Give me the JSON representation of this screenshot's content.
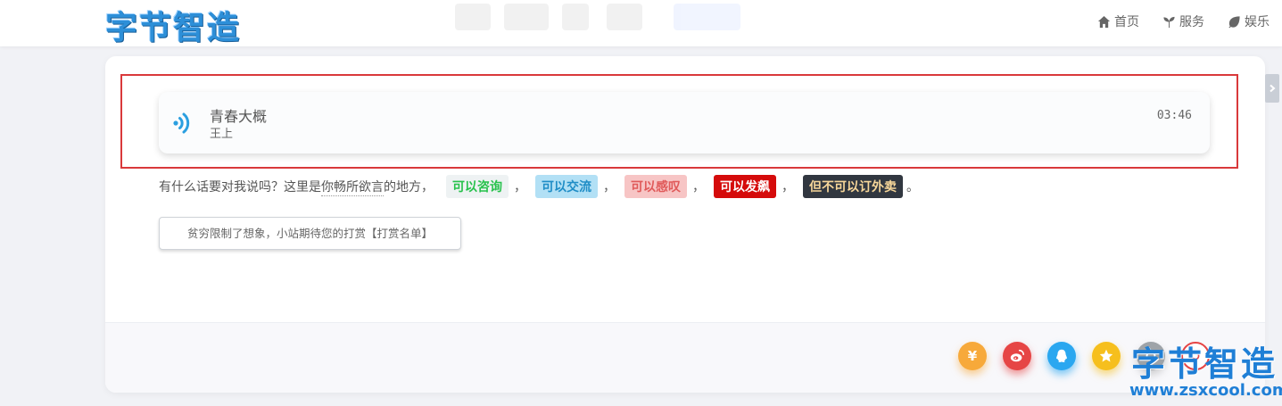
{
  "header": {
    "logo_text": "字节智造",
    "nav": [
      {
        "label": "首页",
        "icon": "home-icon"
      },
      {
        "label": "服务",
        "icon": "sprout-icon"
      },
      {
        "label": "娱乐",
        "icon": "leaf-icon"
      }
    ]
  },
  "player": {
    "title": "青春大概",
    "artist": "王上",
    "time": "03:46",
    "icon": "sound-wave-icon"
  },
  "message": {
    "prefix": "有什么话要对我说吗？这里是",
    "dotted": "你畅所欲言",
    "suffix": "的地方，",
    "tags": [
      "可以咨询",
      "可以交流",
      "可以感叹",
      "可以发飙",
      "但不可以订外卖"
    ],
    "separator": "，",
    "end": "。"
  },
  "reward_button": {
    "label": "贫穷限制了想象，小站期待您的打赏【打赏名单】"
  },
  "social": {
    "yen_label": "¥",
    "icons": [
      "yen-icon",
      "weibo-icon",
      "qq-icon",
      "star-icon",
      "share-icon",
      "outline-icon"
    ]
  },
  "watermark": {
    "title": "字节智造",
    "url": "www.zsxcool.com"
  },
  "colors": {
    "accent": "#2d8fd8",
    "highlight_frame": "#d9393b"
  }
}
